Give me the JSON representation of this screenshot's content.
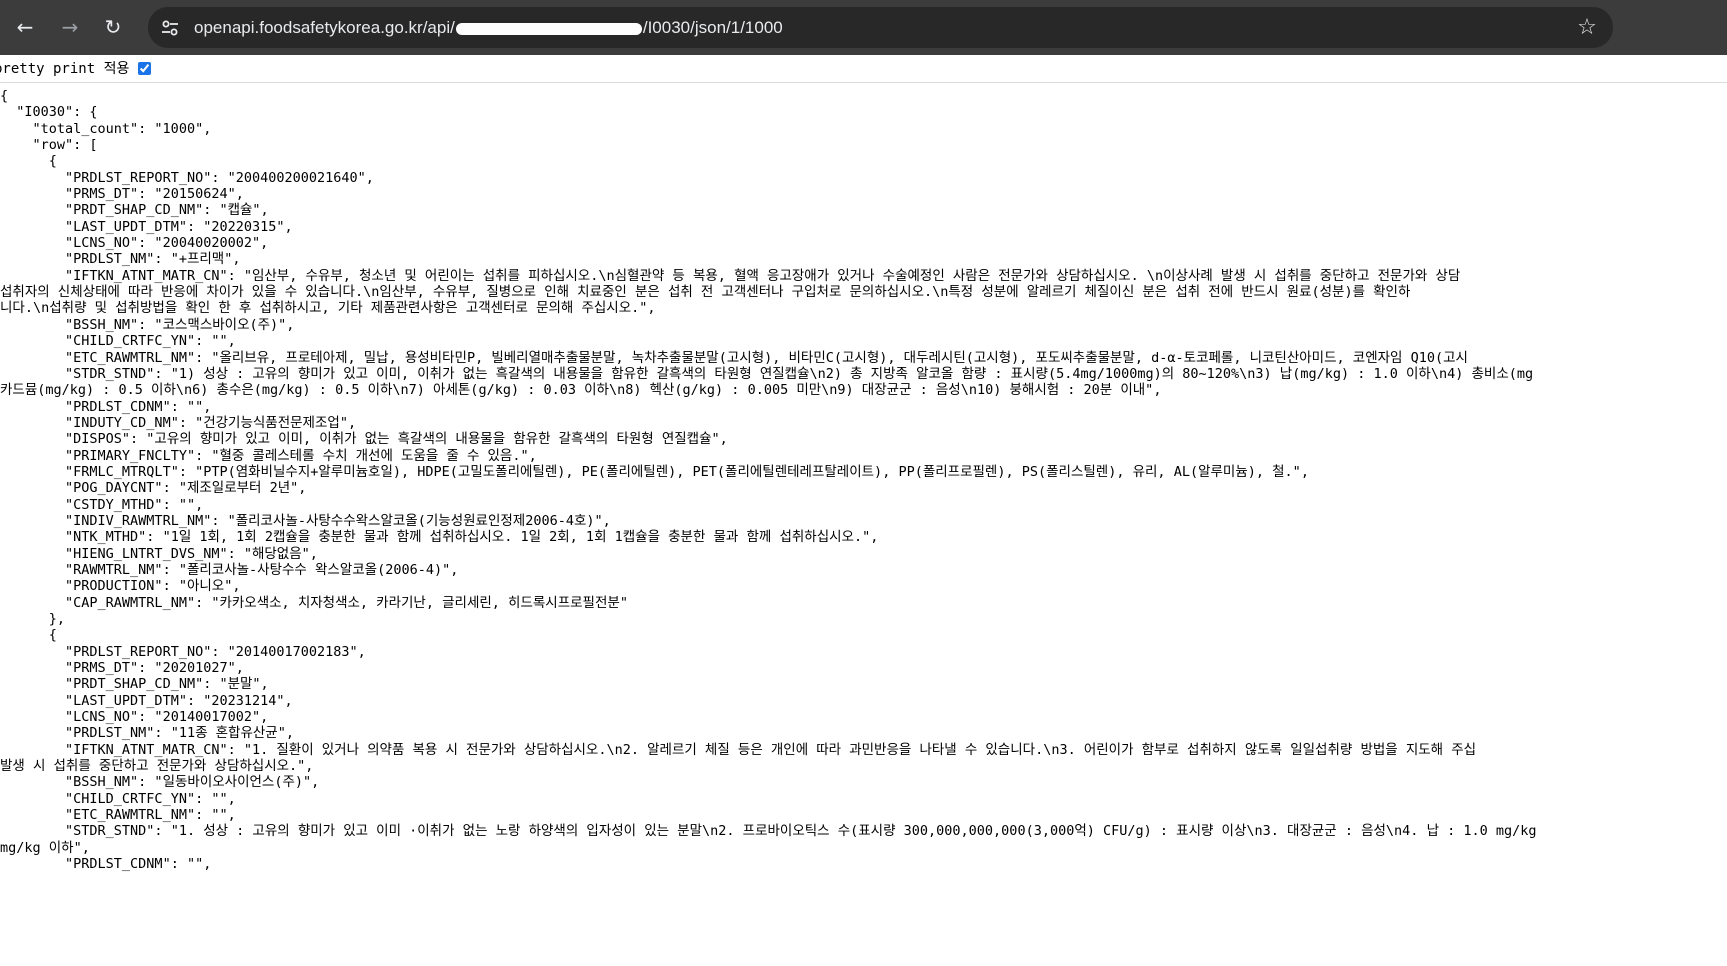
{
  "browser": {
    "url_prefix": "openapi.foodsafetykorea.go.kr/api/",
    "url_suffix": "/I0030/json/1/1000"
  },
  "viewer": {
    "pretty_print_label": "pretty print 적용",
    "pretty_print_checked": true
  },
  "json_text": "{\n  \"I0030\": {\n    \"total_count\": \"1000\",\n    \"row\": [\n      {\n        \"PRDLST_REPORT_NO\": \"200400200021640\",\n        \"PRMS_DT\": \"20150624\",\n        \"PRDT_SHAP_CD_NM\": \"캡슐\",\n        \"LAST_UPDT_DTM\": \"20220315\",\n        \"LCNS_NO\": \"20040020002\",\n        \"PRDLST_NM\": \"+프리맥\",\n        \"IFTKN_ATNT_MATR_CN\": \"임산부, 수유부, 청소년 및 어린이는 섭취를 피하십시오.\\n심혈관약 등 복용, 혈액 응고장애가 있거나 수술예정인 사람은 전문가와 상담하십시오. \\n이상사례 발생 시 섭취를 중단하고 전문가와 상담\n섭취자의 신체상태에 따라 반응에 차이가 있을 수 있습니다.\\n임산부, 수유부, 질병으로 인해 치료중인 분은 섭취 전 고객센터나 구입처로 문의하십시오.\\n특정 성분에 알레르기 체질이신 분은 섭취 전에 반드시 원료(성분)를 확인하\n니다.\\n섭취량 및 섭취방법을 확인 한 후 섭취하시고, 기타 제품관련사항은 고객센터로 문의해 주십시오.\",\n        \"BSSH_NM\": \"코스맥스바이오(주)\",\n        \"CHILD_CRTFC_YN\": \"\",\n        \"ETC_RAWMTRL_NM\": \"올리브유, 프로테아제, 밀납, 용성비타민P, 빌베리열매추출물분말, 녹차추출물분말(고시형), 비타민C(고시형), 대두레시틴(고시형), 포도씨추출물분말, d-α-토코페롤, 니코틴산아미드, 코엔자임 Q10(고시\n        \"STDR_STND\": \"1) 성상 : 고유의 향미가 있고 이미, 이취가 없는 흑갈색의 내용물을 함유한 갈흑색의 타원형 연질캡슐\\n2) 총 지방족 알코올 함량 : 표시량(5.4mg/1000mg)의 80~120%\\n3) 납(mg/kg) : 1.0 이하\\n4) 총비소(mg\n카드뮴(mg/kg) : 0.5 이하\\n6) 총수은(mg/kg) : 0.5 이하\\n7) 아세톤(g/kg) : 0.03 이하\\n8) 헥산(g/kg) : 0.005 미만\\n9) 대장균군 : 음성\\n10) 붕해시험 : 20분 이내\",\n        \"PRDLST_CDNM\": \"\",\n        \"INDUTY_CD_NM\": \"건강기능식품전문제조업\",\n        \"DISPOS\": \"고유의 향미가 있고 이미, 이취가 없는 흑갈색의 내용물을 함유한 갈흑색의 타원형 연질캡슐\",\n        \"PRIMARY_FNCLTY\": \"혈중 콜레스테롤 수치 개선에 도움을 줄 수 있음.\",\n        \"FRMLC_MTRQLT\": \"PTP(염화비닐수지+알루미늄호일), HDPE(고밀도폴리에틸렌), PE(폴리에틸렌), PET(폴리에틸렌테레프탈레이트), PP(폴리프로필렌), PS(폴리스틸렌), 유리, AL(알루미늄), 철.\",\n        \"POG_DAYCNT\": \"제조일로부터 2년\",\n        \"CSTDY_MTHD\": \"\",\n        \"INDIV_RAWMTRL_NM\": \"폴리코사놀-사탕수수왁스알코올(기능성원료인정제2006-4호)\",\n        \"NTK_MTHD\": \"1일 1회, 1회 2캡슐을 충분한 물과 함께 섭취하십시오. 1일 2회, 1회 1캡슐을 충분한 물과 함께 섭취하십시오.\",\n        \"HIENG_LNTRT_DVS_NM\": \"해당없음\",\n        \"RAWMTRL_NM\": \"폴리코사놀-사탕수수 왁스알코올(2006-4)\",\n        \"PRODUCTION\": \"아니오\",\n        \"CAP_RAWMTRL_NM\": \"카카오색소, 치자청색소, 카라기난, 글리세린, 히드록시프로필전분\"\n      },\n      {\n        \"PRDLST_REPORT_NO\": \"20140017002183\",\n        \"PRMS_DT\": \"20201027\",\n        \"PRDT_SHAP_CD_NM\": \"분말\",\n        \"LAST_UPDT_DTM\": \"20231214\",\n        \"LCNS_NO\": \"20140017002\",\n        \"PRDLST_NM\": \"11종 혼합유산균\",\n        \"IFTKN_ATNT_MATR_CN\": \"1. 질환이 있거나 의약품 복용 시 전문가와 상담하십시오.\\n2. 알레르기 체질 등은 개인에 따라 과민반응을 나타낼 수 있습니다.\\n3. 어린이가 함부로 섭취하지 않도록 일일섭취량 방법을 지도해 주십\n발생 시 섭취를 중단하고 전문가와 상담하십시오.\",\n        \"BSSH_NM\": \"일동바이오사이언스(주)\",\n        \"CHILD_CRTFC_YN\": \"\",\n        \"ETC_RAWMTRL_NM\": \"\",\n        \"STDR_STND\": \"1. 성상 : 고유의 향미가 있고 이미 ·이취가 없는 노랑 하양색의 입자성이 있는 분말\\n2. 프로바이오틱스 수(표시량 300,000,000,000(3,000억) CFU/g) : 표시량 이상\\n3. 대장균군 : 음성\\n4. 납 : 1.0 mg/kg\nmg/kg 이하\",\n        \"PRDLST_CDNM\": \"\","
}
